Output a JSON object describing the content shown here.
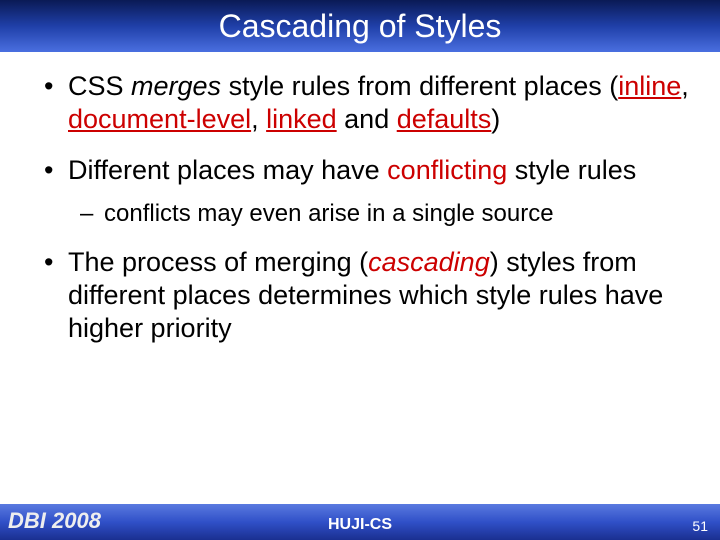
{
  "title": "Cascading of Styles",
  "bullets": [
    {
      "level": 1,
      "pre": "CSS ",
      "em1": "merges",
      "mid1": " style rules from different places (",
      "u1": "inline",
      "mid2": ", ",
      "u2": "document-level",
      "mid3": ", ",
      "u3": "linked",
      "mid4": " and ",
      "u4": "defaults",
      "post": ")"
    },
    {
      "level": 1,
      "pre": "Different places may have ",
      "r1": "conflicting",
      "post": " style rules"
    },
    {
      "level": 2,
      "text": "conflicts may even arise in a single source"
    },
    {
      "level": 1,
      "pre": "The process of merging (",
      "emr": "cascading",
      "post": ") styles from different places determines which style rules have higher priority"
    }
  ],
  "footer": {
    "left": "DBI 2008",
    "center": "HUJI-CS",
    "right": "51"
  }
}
